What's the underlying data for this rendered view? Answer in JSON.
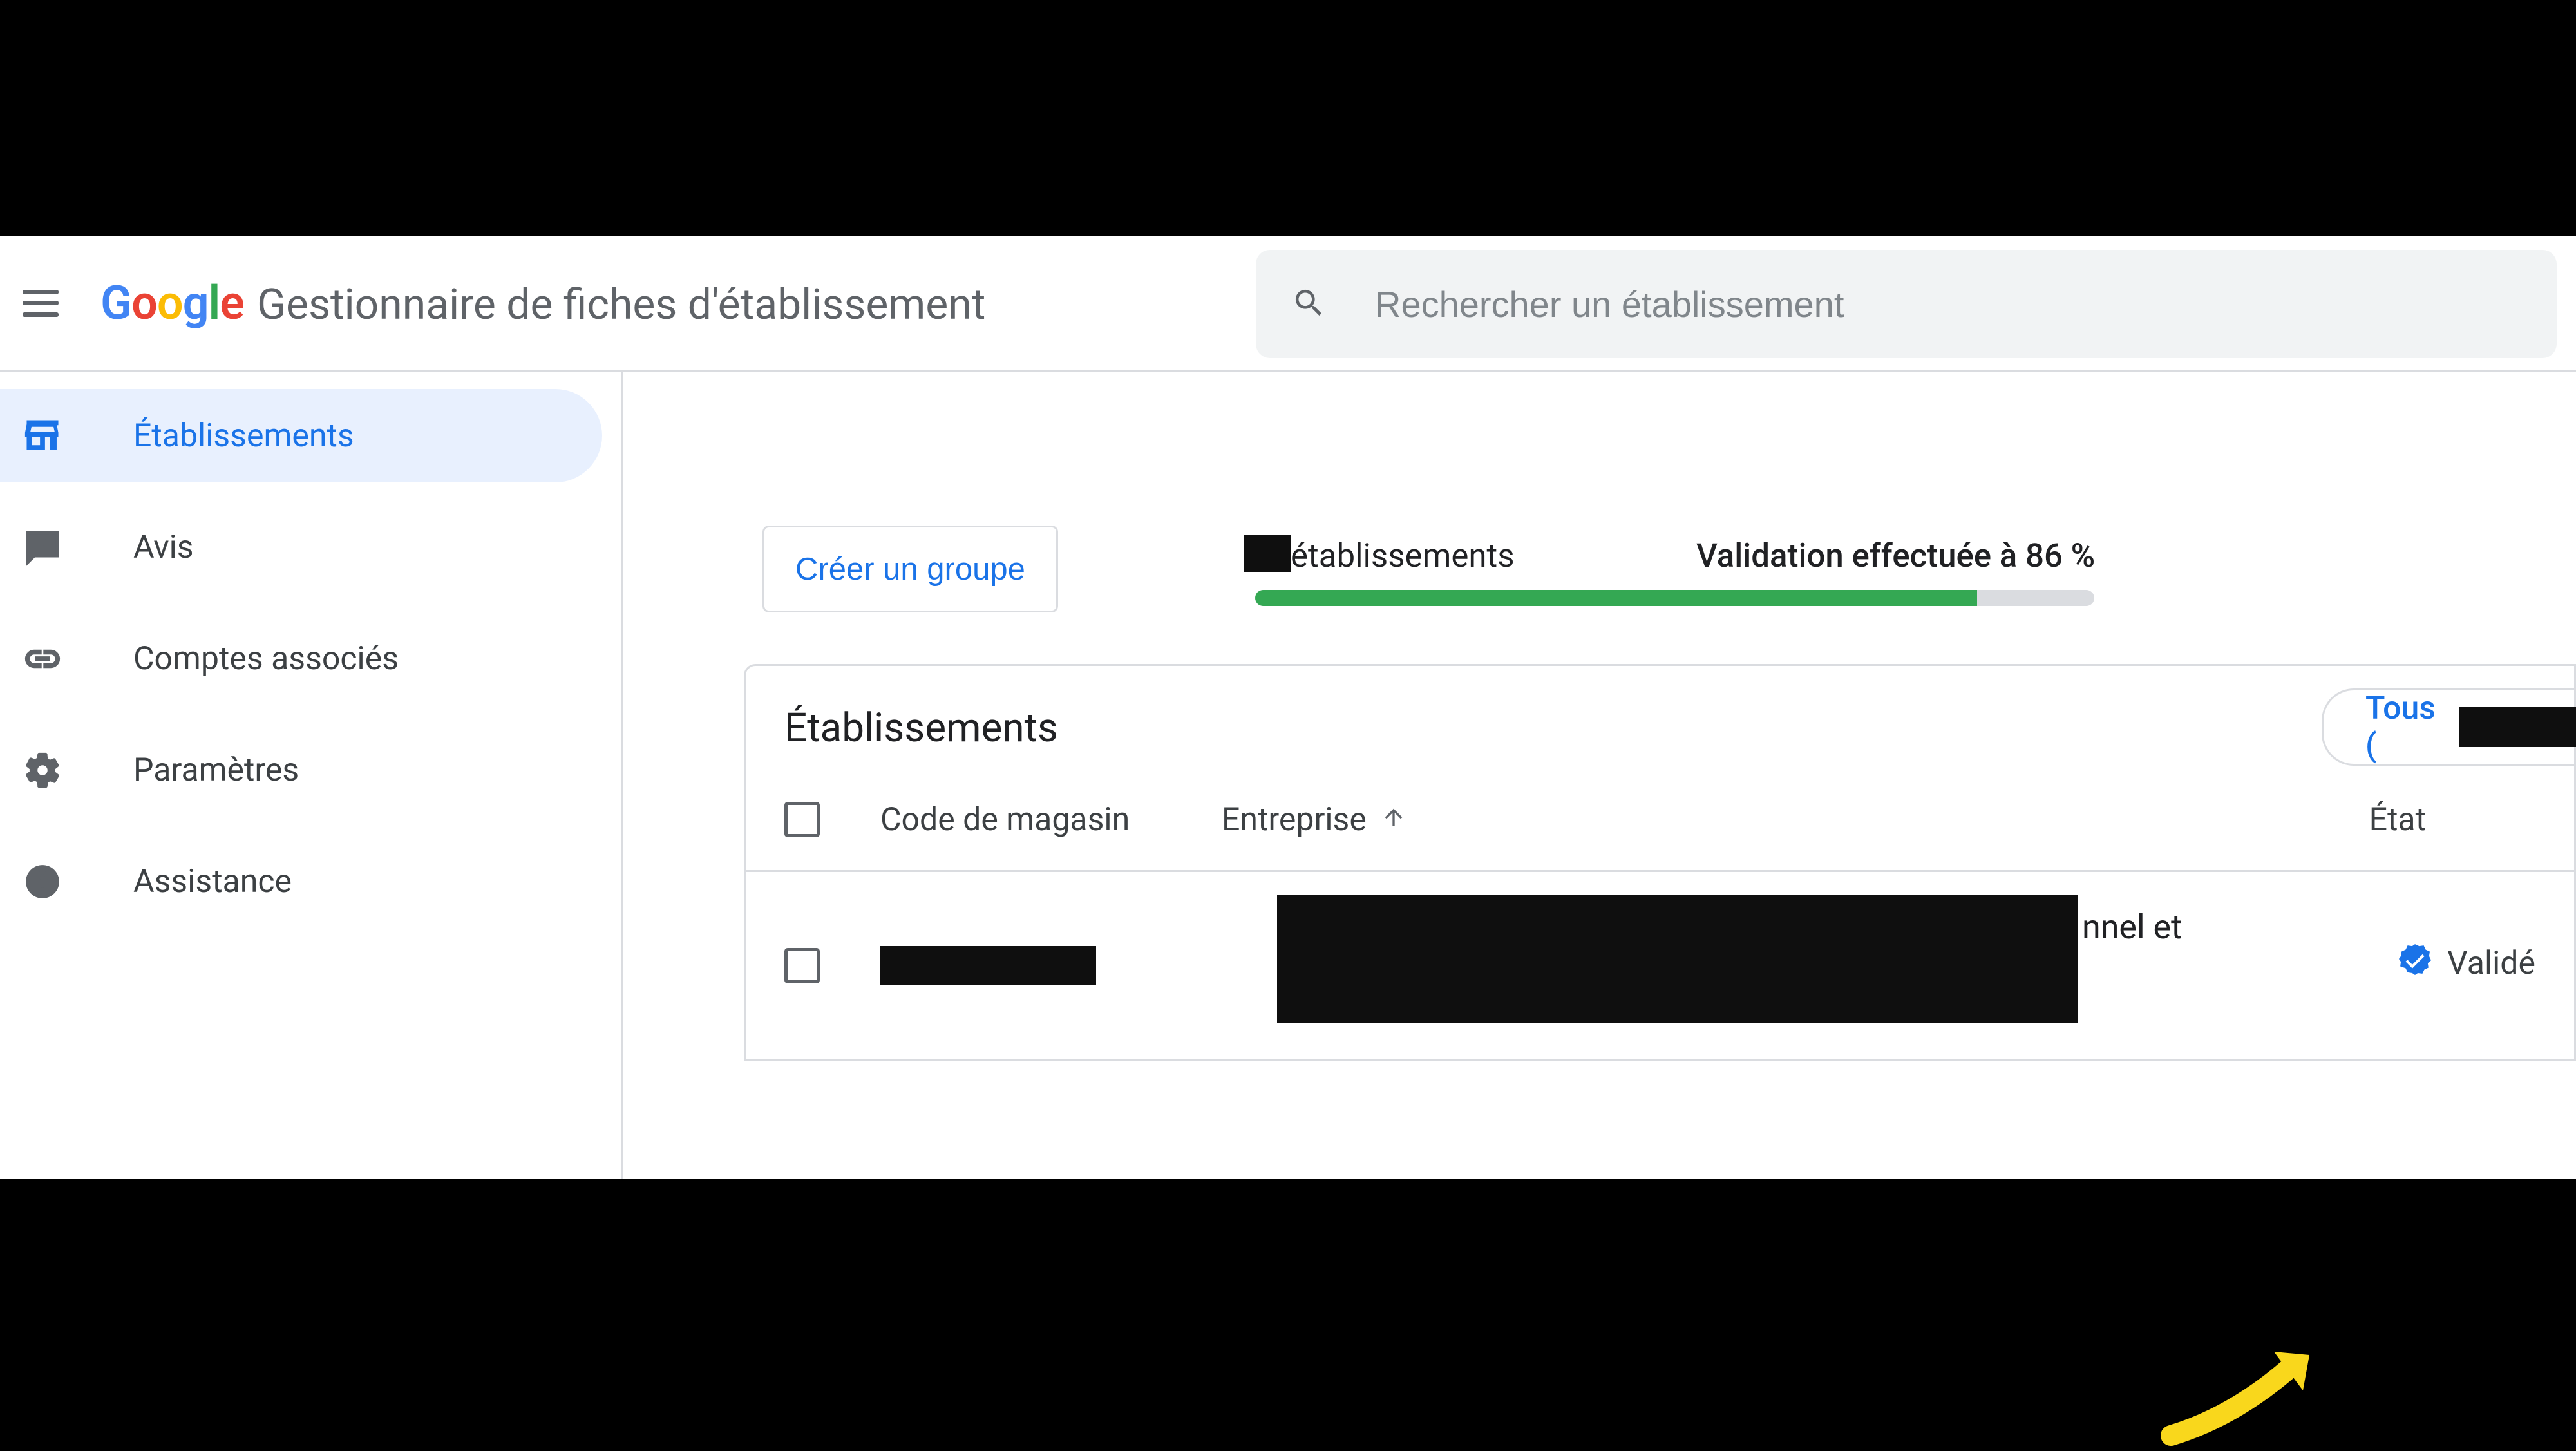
{
  "header": {
    "app_title": "Gestionnaire de fiches d'établissement",
    "search_placeholder": "Rechercher un établissement"
  },
  "sidebar": {
    "items": [
      {
        "label": "Établissements",
        "icon": "storefront-icon",
        "active": true
      },
      {
        "label": "Avis",
        "icon": "reviews-icon",
        "active": false
      },
      {
        "label": "Comptes associés",
        "icon": "link-icon",
        "active": false
      },
      {
        "label": "Paramètres",
        "icon": "gear-icon",
        "active": false
      },
      {
        "label": "Assistance",
        "icon": "help-icon",
        "active": false
      }
    ]
  },
  "main": {
    "create_group_label": "Créer un groupe",
    "establishments_count_label": "établissements",
    "validation_label": "Validation effectuée à 86 %",
    "validation_percent": 86,
    "panel_title": "Établissements",
    "filter_label": "Tous (",
    "columns": {
      "code": "Code de magasin",
      "entreprise": "Entreprise",
      "etat": "État"
    },
    "rows": [
      {
        "code": "[redacted]",
        "entreprise": "[redacted]",
        "entreprise_visible_fragment": "nnel et",
        "etat": "Validé"
      }
    ]
  }
}
